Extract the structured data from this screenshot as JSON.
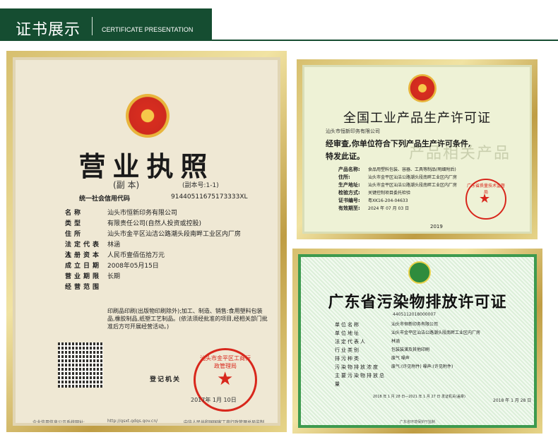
{
  "header": {
    "title": "证书展示",
    "subtitle": "CERTIFICATE PRESENTATION"
  },
  "business_license": {
    "title": "营业执照",
    "copy_label": "(副 本)",
    "serial": "(副本号:1-1)",
    "credit_code_label": "统一社会信用代码",
    "credit_code": "91440511675173333XL",
    "fields": [
      {
        "label": "名称",
        "value": "汕头市恒新印务有限公司"
      },
      {
        "label": "类型",
        "value": "有限责任公司(自然人投资或控股)"
      },
      {
        "label": "住所",
        "value": "汕头市金平区汕洁公路潮头段南畔工业区内厂房"
      },
      {
        "label": "法定代表人",
        "value": "林涵"
      },
      {
        "label": "注册资本",
        "value": "人民币壹佰伍拾万元"
      },
      {
        "label": "成立日期",
        "value": "2008年05月15日"
      },
      {
        "label": "营业期限",
        "value": "长期"
      },
      {
        "label": "经营范围",
        "value": ""
      }
    ],
    "scope": "印刷品印刷(出版物印刷除外);加工、制造、销售:食用塑料包装品,橡胶制品,纸塑工艺制品。(依法须经批准的项目,经相关部门批准后方可开展经营活动。)",
    "registration_authority": "登记机关",
    "date": "2017年 1月 10日",
    "footer_left": "企业信用信息公示系统网址:",
    "footer_middle": "http://gsxt.gdgs.gov.cn/",
    "footer_right": "中华人民共和国国家工商行政管理总局监制",
    "seal_text": "汕头市金平区工商行政管理局"
  },
  "production_license": {
    "title": "全国工业产品生产许可证",
    "company": "汕头市恒新印务有限公司",
    "line1": "经审查,你单位符合下列产品生产许可条件,",
    "line2": "特发此证。",
    "watermark": "产品相关产品",
    "fields": [
      {
        "label": "产品名称:",
        "value": "食品用塑料包装、容器、工具等制品(明细附后)"
      },
      {
        "label": "住所:",
        "value": "汕头市金平区汕洁公路潮头段南畔工业区内厂房"
      },
      {
        "label": "生产地址:",
        "value": "汕头市金平区汕洁公路潮头段南畔工业区内厂房"
      },
      {
        "label": "检验方式:",
        "value": "关键控制项目委托检验"
      },
      {
        "label": "证书编号:",
        "value": "粤XK16-204-04633"
      },
      {
        "label": "有效期至:",
        "value": "2024 年 07 月 03 日"
      }
    ],
    "year": "2019",
    "seal_text": "广东省质量技术监督局"
  },
  "discharge_permit": {
    "title": "广东省污染物排放许可证",
    "code": "4405112018000007",
    "fields": [
      {
        "label": "单位名称",
        "value": "汕头市恒新印务有限公司"
      },
      {
        "label": "单位地址",
        "value": "汕头市金平区汕洁公路潮头段南畔工业区内厂房"
      },
      {
        "label": "法定代表人",
        "value": "林涵"
      },
      {
        "label": "行业类别",
        "value": "包装装潢及其他印刷"
      },
      {
        "label": "排污种类",
        "value": "废气 噪声"
      },
      {
        "label": "污染物排放浓度",
        "value": "废气:(许见附件) 噪声:(许见附件)"
      },
      {
        "label": "主要污染物排放总量",
        "value": ""
      }
    ],
    "validity": "2018 年 1 月 28 日—2021 年 1 月 27 日 发证机关(盖章)",
    "year": "2018 年 1 月 28 日",
    "footer": "广东省环境保护厅监制"
  }
}
